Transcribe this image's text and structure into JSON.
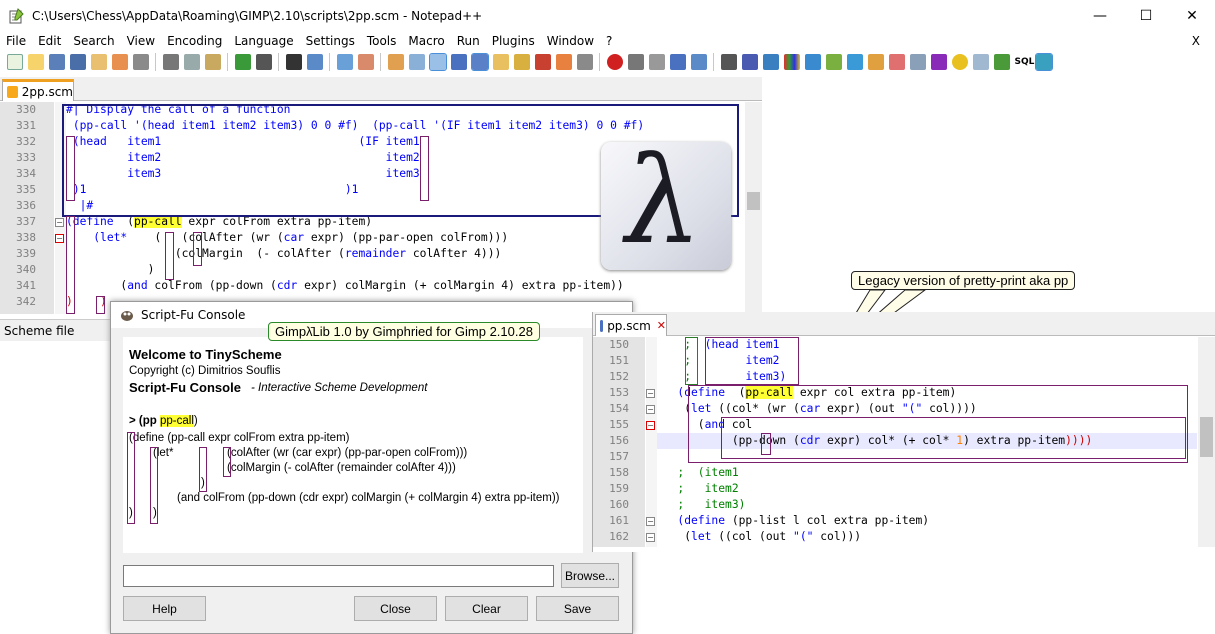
{
  "window": {
    "title": "C:\\Users\\Chess\\AppData\\Roaming\\GIMP\\2.10\\scripts\\2pp.scm - Notepad++",
    "minimize": "—",
    "maximize": "☐",
    "close": "✕"
  },
  "menu": {
    "items": [
      "File",
      "Edit",
      "Search",
      "View",
      "Encoding",
      "Language",
      "Settings",
      "Tools",
      "Macro",
      "Run",
      "Plugins",
      "Window",
      "?"
    ],
    "close": "X"
  },
  "main_editor": {
    "tab": "2pp.scm",
    "status_language": "Scheme file",
    "line_numbers": [
      "330",
      "331",
      "332",
      "333",
      "334",
      "335",
      "336",
      "337",
      "338",
      "339",
      "340",
      "341",
      "342"
    ]
  },
  "callouts": {
    "legacy": "Legacy version of pretty-print aka pp",
    "gimplib": "Gimpλ̄Lib 1.0 by Gimphried for Gimp 2.10.28"
  },
  "console": {
    "title": "Script-Fu Console",
    "welcome": "Welcome to TinyScheme",
    "copyright": "Copyright (c) Dimitrios Souflis",
    "heading": "Script-Fu Console",
    "subtitle": "- Interactive Scheme Development",
    "prompt": "> (pp ",
    "prompt_sel": "pp-call",
    "prompt_end": ")",
    "out1": "(define   (pp-call expr colFrom extra pp-item)",
    "out2": "(let*",
    "out3": "(colAfter (wr (car expr) (pp-par-open colFrom)))",
    "out4": "(colMargin (- colAfter (remainder colAfter 4)))",
    "out5": ")",
    "out6": "(and colFrom (pp-down (cdr expr) colMargin (+ colMargin 4) extra pp-item))",
    "out7": ")",
    "out8": ")",
    "input_value": "",
    "browse": "Browse...",
    "help": "Help",
    "close": "Close",
    "clear": "Clear",
    "save": "Save"
  },
  "second_editor": {
    "tab": "pp.scm",
    "line_numbers": [
      "150",
      "151",
      "152",
      "153",
      "154",
      "155",
      "156",
      "157",
      "158",
      "159",
      "160",
      "161",
      "162"
    ]
  }
}
